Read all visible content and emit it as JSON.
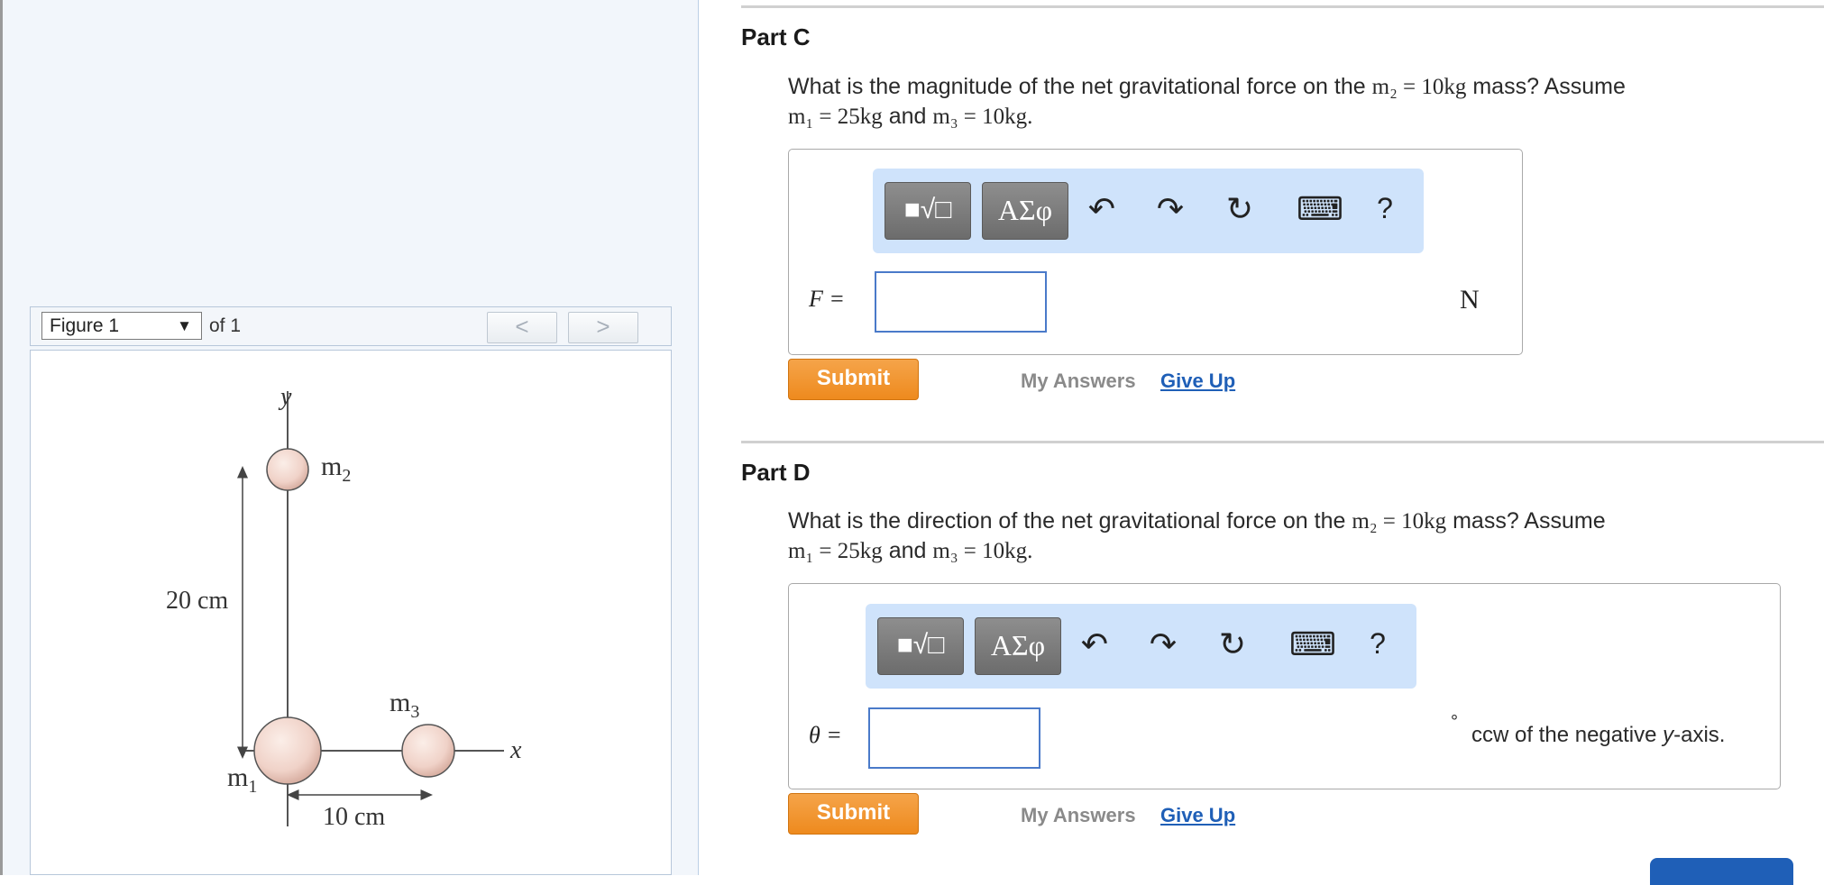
{
  "figure_panel": {
    "selected": "Figure 1",
    "of_label": "of 1",
    "prev_glyph": "<",
    "next_glyph": ">"
  },
  "figure": {
    "y_label": "y",
    "x_label": "x",
    "m1_label": "m",
    "m1_sub": "1",
    "m2_label": "m",
    "m2_sub": "2",
    "m3_label": "m",
    "m3_sub": "3",
    "vertical_dim": "20 cm",
    "horizontal_dim": "10 cm"
  },
  "parts": [
    {
      "title": "Part C",
      "question_pre": "What is the magnitude of the net gravitational force on the",
      "question_post": "mass? Assume",
      "given_m2": "m₂ = 10kg",
      "given_m1": "m₁ = 25kg",
      "conj": "and",
      "given_m3": "m₃ = 10kg.",
      "var_label": "F =",
      "unit": "N",
      "submit": "Submit",
      "my_answers": "My Answers",
      "give_up": "Give Up",
      "toolbar": {
        "templates": "■√□",
        "greek": "ΑΣφ",
        "undo": "↶",
        "redo": "↷",
        "reset": "↻",
        "keyboard": "⌨",
        "help": "?"
      }
    },
    {
      "title": "Part D",
      "question_pre": "What is the direction of the net gravitational force on the",
      "question_post": "mass? Assume",
      "given_m2": "m₂ = 10kg",
      "given_m1": "m₁ = 25kg",
      "conj": "and",
      "given_m3": "m₃ = 10kg.",
      "var_label": "θ =",
      "unit_degree": "°",
      "unit_text_pre": "ccw of the negative ",
      "unit_text_italic": "y",
      "unit_text_post": "-axis.",
      "submit": "Submit",
      "my_answers": "My Answers",
      "give_up": "Give Up",
      "toolbar": {
        "templates": "■√□",
        "greek": "ΑΣφ",
        "undo": "↶",
        "redo": "↷",
        "reset": "↻",
        "keyboard": "⌨",
        "help": "?"
      }
    }
  ]
}
